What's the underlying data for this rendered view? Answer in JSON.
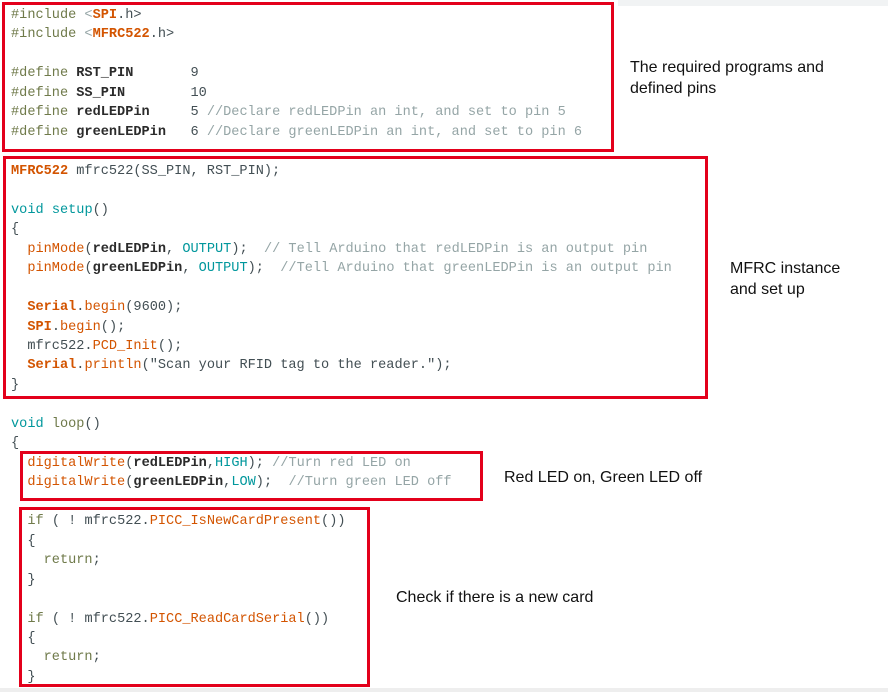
{
  "colors": {
    "box": "#e3001b",
    "keyword": "#6f7a4a",
    "type": "#00979c",
    "function": "#d35400",
    "comment": "#95a5a6"
  },
  "code_lines": [
    [
      [
        "k",
        "#include "
      ],
      [
        "m",
        "<"
      ],
      [
        "o",
        "SPI"
      ],
      [
        "",
        ".h>"
      ]
    ],
    [
      [
        "k",
        "#include "
      ],
      [
        "m",
        "<"
      ],
      [
        "o",
        "MFRC522"
      ],
      [
        "",
        ".h>"
      ]
    ],
    [],
    [
      [
        "k",
        "#define "
      ],
      [
        "b",
        "RST_PIN       "
      ],
      [
        "",
        "9"
      ]
    ],
    [
      [
        "k",
        "#define "
      ],
      [
        "b",
        "SS_PIN        "
      ],
      [
        "",
        "10"
      ]
    ],
    [
      [
        "k",
        "#define "
      ],
      [
        "b",
        "redLEDPin     "
      ],
      [
        "",
        "5 "
      ],
      [
        "m",
        "//Declare redLEDPin an int, and set to pin 5"
      ]
    ],
    [
      [
        "k",
        "#define "
      ],
      [
        "b",
        "greenLEDPin   "
      ],
      [
        "",
        "6 "
      ],
      [
        "m",
        "//Declare greenLEDPin an int, and set to pin 6"
      ]
    ],
    [],
    [
      [
        "o",
        "MFRC522"
      ],
      [
        "",
        " mfrc522(SS_PIN, RST_PIN);"
      ]
    ],
    [],
    [
      [
        "t",
        "void"
      ],
      [
        "",
        " "
      ],
      [
        "t",
        "setup"
      ],
      [
        "",
        "()"
      ]
    ],
    [
      [
        "",
        "{"
      ]
    ],
    [
      [
        "",
        "  "
      ],
      [
        "f",
        "pinMode"
      ],
      [
        "",
        "("
      ],
      [
        "b",
        "redLEDPin"
      ],
      [
        "",
        ", "
      ],
      [
        "c",
        "OUTPUT"
      ],
      [
        "",
        ");  "
      ],
      [
        "m",
        "// Tell Arduino that redLEDPin is an output pin"
      ]
    ],
    [
      [
        "",
        "  "
      ],
      [
        "f",
        "pinMode"
      ],
      [
        "",
        "("
      ],
      [
        "b",
        "greenLEDPin"
      ],
      [
        "",
        ", "
      ],
      [
        "c",
        "OUTPUT"
      ],
      [
        "",
        ");  "
      ],
      [
        "m",
        "//Tell Arduino that greenLEDPin is an output pin"
      ]
    ],
    [],
    [
      [
        "",
        "  "
      ],
      [
        "o",
        "Serial"
      ],
      [
        "",
        "."
      ],
      [
        "f",
        "begin"
      ],
      [
        "",
        "(9600);"
      ]
    ],
    [
      [
        "",
        "  "
      ],
      [
        "o",
        "SPI"
      ],
      [
        "",
        "."
      ],
      [
        "f",
        "begin"
      ],
      [
        "",
        "();"
      ]
    ],
    [
      [
        "",
        "  mfrc522."
      ],
      [
        "f",
        "PCD_Init"
      ],
      [
        "",
        "();"
      ]
    ],
    [
      [
        "",
        "  "
      ],
      [
        "o",
        "Serial"
      ],
      [
        "",
        "."
      ],
      [
        "f",
        "println"
      ],
      [
        "",
        "(\"Scan your RFID tag to the reader.\");"
      ]
    ],
    [
      [
        "",
        "}"
      ]
    ],
    [],
    [
      [
        "t",
        "void"
      ],
      [
        "",
        " "
      ],
      [
        "k",
        "loop"
      ],
      [
        "",
        "()"
      ]
    ],
    [
      [
        "",
        "{"
      ]
    ],
    [
      [
        "",
        "  "
      ],
      [
        "f",
        "digitalWrite"
      ],
      [
        "",
        "("
      ],
      [
        "b",
        "redLEDPin"
      ],
      [
        "",
        ","
      ],
      [
        "c",
        "HIGH"
      ],
      [
        "",
        "); "
      ],
      [
        "m",
        "//Turn red LED on"
      ]
    ],
    [
      [
        "",
        "  "
      ],
      [
        "f",
        "digitalWrite"
      ],
      [
        "",
        "("
      ],
      [
        "b",
        "greenLEDPin"
      ],
      [
        "",
        ","
      ],
      [
        "c",
        "LOW"
      ],
      [
        "",
        ");  "
      ],
      [
        "m",
        "//Turn green LED off"
      ]
    ],
    [],
    [
      [
        "",
        "  "
      ],
      [
        "k",
        "if"
      ],
      [
        "",
        " ( ! mfrc522."
      ],
      [
        "f",
        "PICC_IsNewCardPresent"
      ],
      [
        "",
        "())"
      ]
    ],
    [
      [
        "",
        "  {"
      ]
    ],
    [
      [
        "",
        "    "
      ],
      [
        "k",
        "return"
      ],
      [
        "",
        ";"
      ]
    ],
    [
      [
        "",
        "  }"
      ]
    ],
    [],
    [
      [
        "",
        "  "
      ],
      [
        "k",
        "if"
      ],
      [
        "",
        " ( ! mfrc522."
      ],
      [
        "f",
        "PICC_ReadCardSerial"
      ],
      [
        "",
        "())"
      ]
    ],
    [
      [
        "",
        "  {"
      ]
    ],
    [
      [
        "",
        "    "
      ],
      [
        "k",
        "return"
      ],
      [
        "",
        ";"
      ]
    ],
    [
      [
        "",
        "  }"
      ]
    ]
  ],
  "annotations": {
    "includes": [
      "The required programs and",
      "defined pins"
    ],
    "setup": [
      "MFRC instance",
      "and set up"
    ],
    "leds": "Red LED on, Green LED off",
    "card": "Check if there is a new card"
  }
}
